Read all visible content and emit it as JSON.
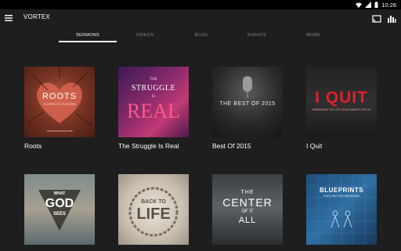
{
  "status": {
    "time": "10:26"
  },
  "app": {
    "title": "VORTEX"
  },
  "tabs": [
    {
      "label": "SERMONS"
    },
    {
      "label": "VIDEOS"
    },
    {
      "label": "BLOG"
    },
    {
      "label": "EVENTS"
    },
    {
      "label": "MORE"
    }
  ],
  "series": [
    {
      "title": "Roots",
      "art": {
        "main": "ROOTS",
        "sub": "PLANTED TO FLOURISH",
        "url": "VORTEXCHURCH.COM"
      }
    },
    {
      "title": "The Struggle Is Real",
      "art": {
        "line1": "THE",
        "line2": "STRUGGLE",
        "line3": "IS",
        "line4": "REAL"
      }
    },
    {
      "title": "Best Of 2015",
      "art": {
        "main": "THE BEST OF 2015"
      }
    },
    {
      "title": "I Quit",
      "art": {
        "main": "I QUIT",
        "sub": "EMBRACING THE LIFE JESUS WANTS FOR US"
      }
    },
    {
      "title": "",
      "art": {
        "line1": "WHAT",
        "line2": "GOD",
        "line3": "SEES"
      }
    },
    {
      "title": "",
      "art": {
        "line1": "BACK TO",
        "line2": "LIFE"
      }
    },
    {
      "title": "",
      "art": {
        "line1": "THE",
        "line2": "CENTER",
        "line3": "OF IT",
        "line4": "ALL"
      }
    },
    {
      "title": "",
      "art": {
        "line1": "BLUEPRINTS",
        "line2": "FOR A BETTER MARRIAGE"
      }
    }
  ],
  "colors": {
    "background": "#1e1e1e",
    "statusbar": "#000000",
    "tab_active": "#ffffff",
    "tab_inactive": "#8a8a8a",
    "quit_red": "#e0202a"
  }
}
